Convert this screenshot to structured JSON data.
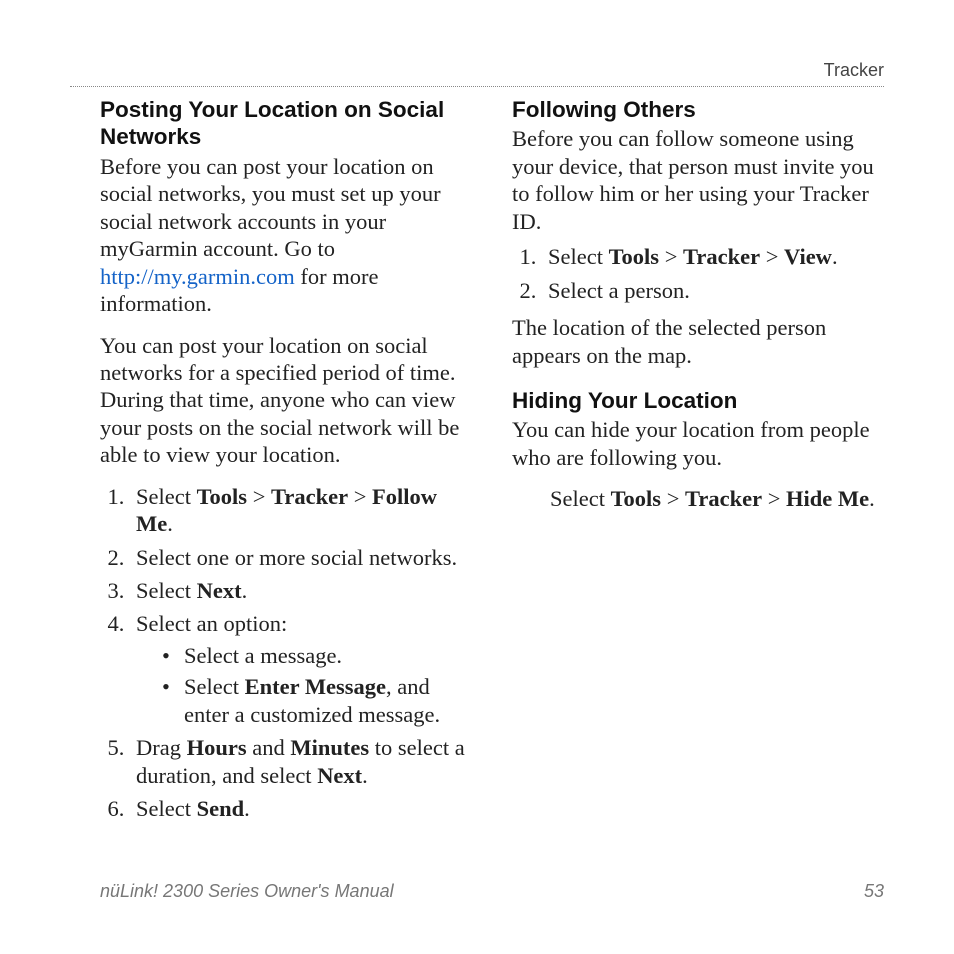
{
  "header": {
    "section": "Tracker"
  },
  "footer": {
    "manual": "nüLink! 2300 Series Owner's Manual",
    "page": "53"
  },
  "col": {
    "posting": {
      "title": "Posting Your Location on Social Networks",
      "p1a": "Before you can post your location on social networks, you must set up your social network accounts in your myGarmin account. Go to ",
      "link": "http://my.garmin.com",
      "p1b": " for more information.",
      "p2": "You can post your location on social networks for a specified period of time. During that time, anyone who can view your posts on the social network will be able to view your location.",
      "s1a": "Select ",
      "s1b": "Tools",
      "s1c": " > ",
      "s1d": "Tracker",
      "s1e": " > ",
      "s1f": "Follow Me",
      "s1g": ".",
      "s2": "Select one or more social networks.",
      "s3a": "Select ",
      "s3b": "Next",
      "s3c": ".",
      "s4": "Select an option:",
      "s4b1": "Select a message.",
      "s4b2a": "Select ",
      "s4b2b": "Enter Message",
      "s4b2c": ", and enter a customized message.",
      "s5a": "Drag ",
      "s5b": "Hours",
      "s5c": " and ",
      "s5d": "Minutes",
      "s5e": " to select a duration, and select ",
      "s5f": "Next",
      "s5g": ".",
      "s6a": "Select ",
      "s6b": "Send",
      "s6c": "."
    },
    "following": {
      "title": "Following Others",
      "p1": "Before you can follow someone using your device, that person must invite you to follow him or her using your Tracker ID.",
      "s1a": "Select ",
      "s1b": "Tools",
      "s1c": " > ",
      "s1d": "Tracker",
      "s1e": " > ",
      "s1f": "View",
      "s1g": ".",
      "s2": "Select a person.",
      "p2": "The location of the selected person appears on the map."
    },
    "hiding": {
      "title": "Hiding Your Location",
      "p1": "You can hide your location from people who are following you.",
      "s1a": "Select ",
      "s1b": "Tools",
      "s1c": " > ",
      "s1d": "Tracker",
      "s1e": " > ",
      "s1f": "Hide Me",
      "s1g": "."
    }
  }
}
